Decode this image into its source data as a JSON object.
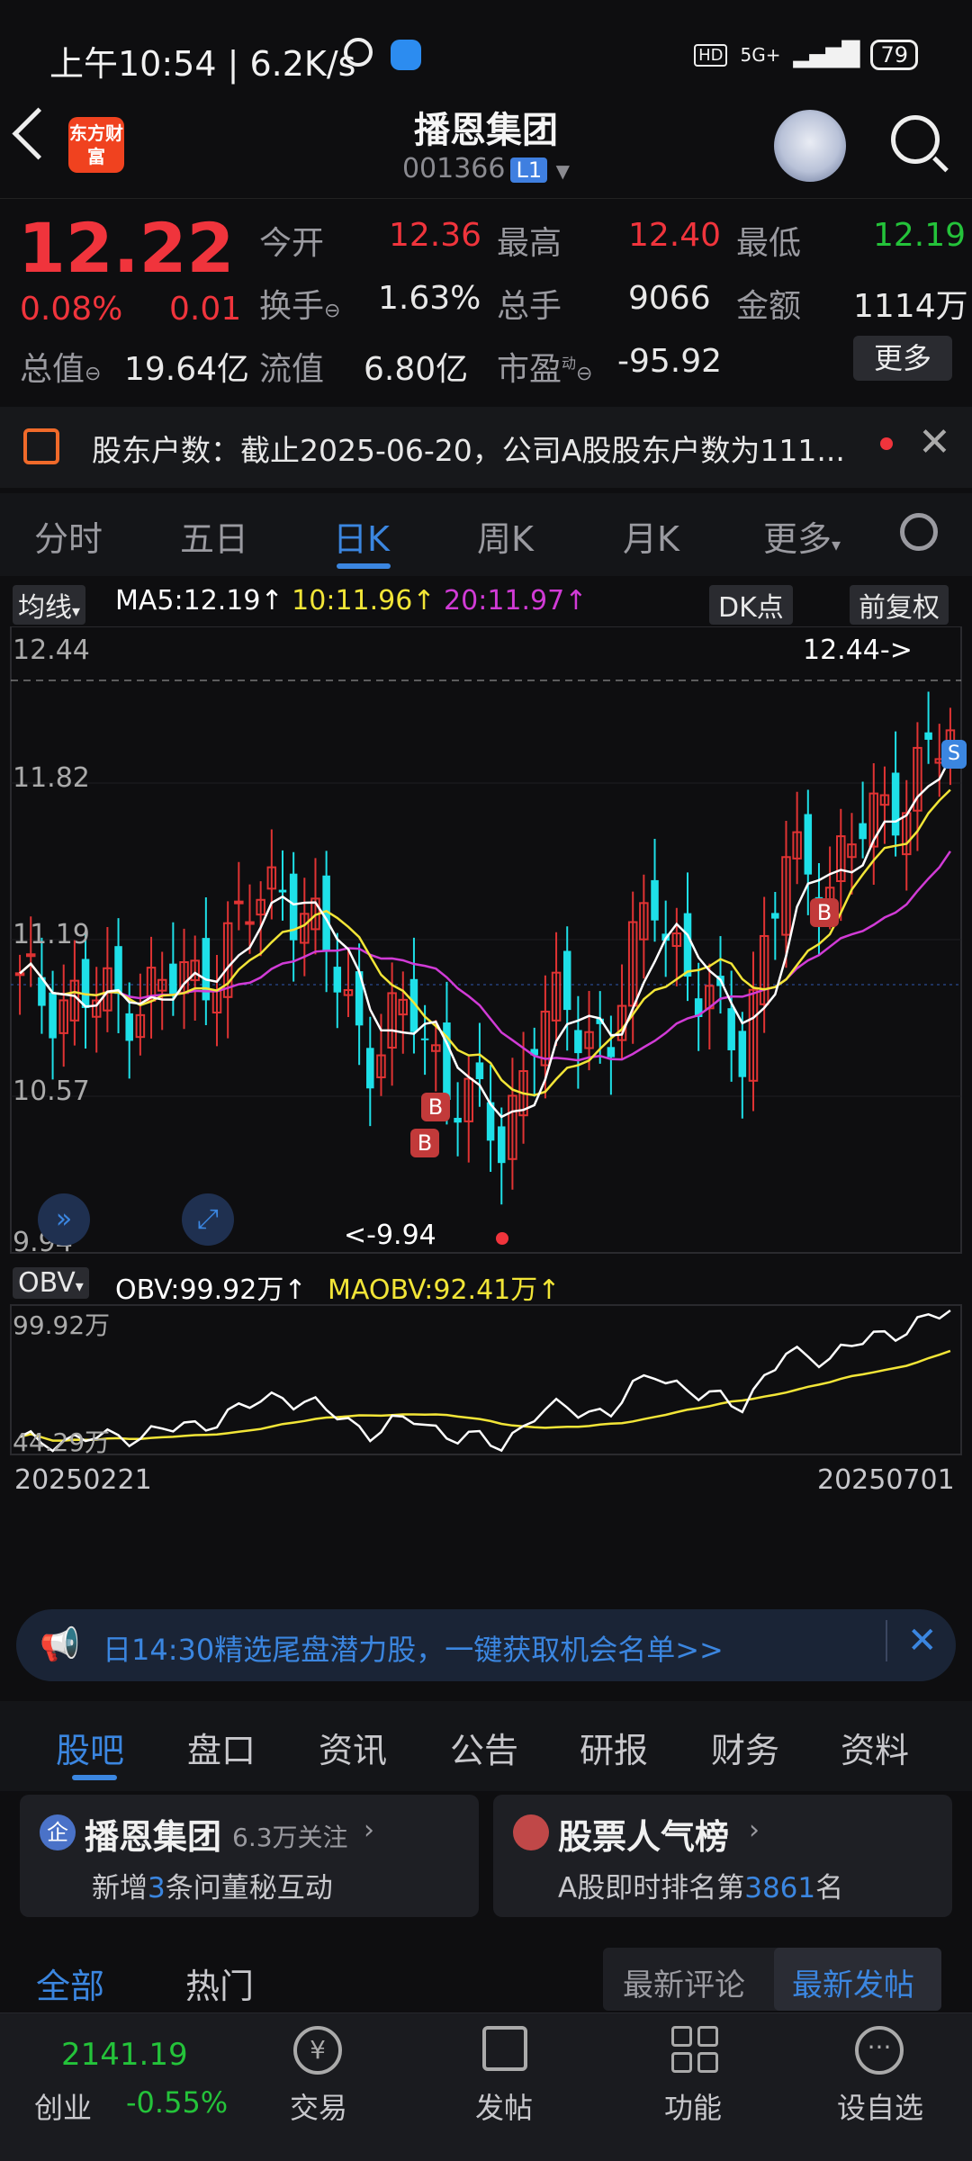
{
  "status_bar": {
    "time": "上午10:54 | 6.2K/s",
    "hd": "HD",
    "network": "5G+",
    "battery": "79"
  },
  "header": {
    "logo_text": "东方财富",
    "stock_name": "播恩集团",
    "stock_code": "001366",
    "level": "L1"
  },
  "quote": {
    "price": "12.22",
    "change_pct": "0.08%",
    "change": "0.01",
    "open_label": "今开",
    "open": "12.36",
    "high_label": "最高",
    "high": "12.40",
    "low_label": "最低",
    "low": "12.19",
    "turnover_label": "换手",
    "turnover": "1.63%",
    "volume_label": "总手",
    "volume": "9066",
    "amount_label": "金额",
    "amount": "1114万",
    "mktcap_label": "总值",
    "mktcap": "19.64亿",
    "float_label": "流值",
    "float": "6.80亿",
    "pe_label": "市盈",
    "pe_sup": "动",
    "pe": "-95.92",
    "more": "更多"
  },
  "notice": {
    "text": "股东户数：截止2025-06-20，公司A股股东户数为111..."
  },
  "tabs": [
    "分时",
    "五日",
    "日K",
    "周K",
    "月K",
    "更多"
  ],
  "active_tab": "日K",
  "chart_controls": {
    "ma_select": "均线",
    "ma5": "MA5:12.19",
    "ma10": "10:11.96",
    "ma20": "20:11.97",
    "dk": "DK点",
    "adjust": "前复权"
  },
  "chart_data": {
    "type": "candlestick",
    "y_ticks": [
      "12.44",
      "11.82",
      "11.19",
      "10.57",
      "9.94"
    ],
    "ylim": [
      9.94,
      12.44
    ],
    "high_marker": "12.44->",
    "low_marker": "<-9.94",
    "x_start": "20250221",
    "x_end": "20250701",
    "obv": {
      "select": "OBV",
      "obv_label": "OBV:99.92万",
      "maobv_label": "MAOBV:92.41万",
      "max_label": "99.92万",
      "min_label": "44.29万"
    },
    "colors": {
      "up": "#e03333",
      "down": "#1ee0e8",
      "ma5": "#ffffff",
      "ma10": "#f2e537",
      "ma20": "#d13bd6"
    }
  },
  "promo": {
    "text": "日14:30精选尾盘潜力股，一键获取机会名单>>"
  },
  "sub_tabs": [
    "股吧",
    "盘口",
    "资讯",
    "公告",
    "研报",
    "财务",
    "资料"
  ],
  "active_sub_tab": "股吧",
  "cards": {
    "left": {
      "badge": "企",
      "title": "播恩集团",
      "follow": "6.3万关注",
      "sub_pre": "新增",
      "sub_num": "3",
      "sub_post": "条问董秘互动"
    },
    "right": {
      "title": "股票人气榜",
      "sub_pre": "A股即时排名第",
      "sub_num": "3861",
      "sub_post": "名"
    }
  },
  "filters": {
    "all": "全部",
    "hot": "热门",
    "latest_comment": "最新评论",
    "latest_post": "最新发帖"
  },
  "bottom_nav": {
    "index_value": "2141.19",
    "index_name": "创业",
    "index_change": "-0.55%",
    "trade": "交易",
    "post": "发帖",
    "func": "功能",
    "watchlist": "设自选"
  }
}
